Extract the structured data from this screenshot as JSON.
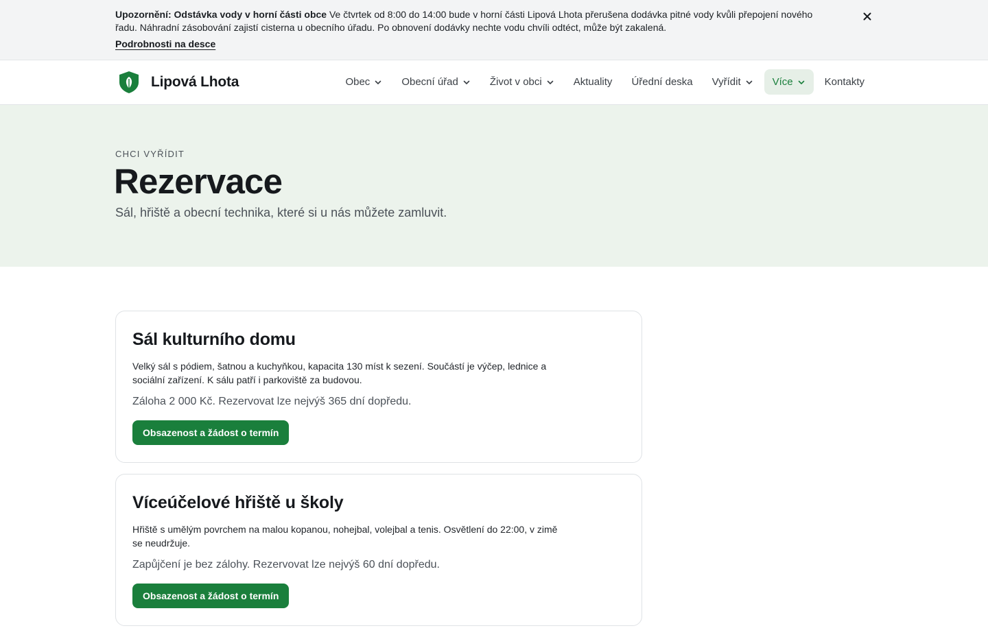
{
  "alert": {
    "title": "Upozornění: Odstávka vody v horní části obce",
    "text": " Ve čtvrtek od 8:00 do 14:00 bude v horní části Lipová Lhota přerušena dodávka pitné vody kvůli přepojení nového řadu. Náhradní zásobování zajistí cisterna u obecního úřadu. Po obnovení dodávky nechte vodu chvíli odtéct, může být zakalená.",
    "link": "Podrobnosti na desce"
  },
  "header": {
    "brand": "Lipová Lhota",
    "nav": [
      {
        "label": "Obec",
        "dropdown": true
      },
      {
        "label": "Obecní úřad",
        "dropdown": true
      },
      {
        "label": "Život v obci",
        "dropdown": true
      },
      {
        "label": "Aktuality",
        "dropdown": false
      },
      {
        "label": "Úřední deska",
        "dropdown": false
      },
      {
        "label": "Vyřídit",
        "dropdown": true
      },
      {
        "label": "Více",
        "dropdown": true,
        "active": true
      },
      {
        "label": "Kontakty",
        "dropdown": false
      }
    ]
  },
  "hero": {
    "eyebrow": "CHCI VYŘÍDIT",
    "title": "Rezervace",
    "subtitle": "Sál, hřiště a obecní technika, které si u nás můžete zamluvit."
  },
  "cards": [
    {
      "title": "Sál kulturního domu",
      "description": "Velký sál s pódiem, šatnou a kuchyňkou, kapacita 130 míst k sezení. Součástí je výčep, lednice a sociální zařízení. K sálu patří i parkoviště za budovou.",
      "note": "Záloha 2 000 Kč. Rezervovat lze nejvýš 365 dní dopředu.",
      "button": "Obsazenost a žádost o termín"
    },
    {
      "title": "Víceúčelové hřiště u školy",
      "description": "Hřiště s umělým povrchem na malou kopanou, nohejbal, volejbal a tenis. Osvětlení do 22:00, v zimě se neudržuje.",
      "note": "Zapůjčení je bez zálohy. Rezervovat lze nejvýš 60 dní dopředu.",
      "button": "Obsazenost a žádost o termín"
    }
  ],
  "colors": {
    "accent": "#1a7f3c",
    "hero_bg": "#ecf3ec",
    "alert_bg": "#f3f4f5"
  },
  "icons": {
    "logo": "leaf-shield-icon",
    "close": "close-icon",
    "dropdown": "chevron-down-icon"
  }
}
